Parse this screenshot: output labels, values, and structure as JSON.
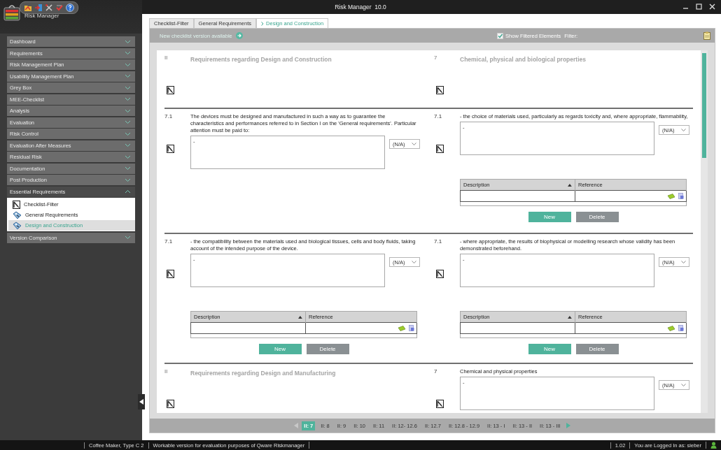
{
  "window": {
    "title": "Risk Manager  10.0"
  },
  "app": {
    "name": "Risk Manager"
  },
  "sidebar": {
    "items": [
      {
        "label": "Dashboard",
        "expanded": false
      },
      {
        "label": "Requirements",
        "expanded": false
      },
      {
        "label": "Risk Management Plan",
        "expanded": false
      },
      {
        "label": "Usability Management Plan",
        "expanded": false
      },
      {
        "label": "Grey Box",
        "expanded": false
      },
      {
        "label": "MEE-Checklist",
        "expanded": false
      },
      {
        "label": "Analysis",
        "expanded": false
      },
      {
        "label": "Evaluation",
        "expanded": false
      },
      {
        "label": "Risk Control",
        "expanded": false
      },
      {
        "label": "Evaluation After Measures",
        "expanded": false
      },
      {
        "label": "Residual Risk",
        "expanded": false
      },
      {
        "label": "Documentation",
        "expanded": false
      },
      {
        "label": "Post Production",
        "expanded": false
      },
      {
        "label": "Essential Requirements",
        "expanded": true,
        "children": [
          {
            "label": "Checklist-Filter",
            "kind": "filter",
            "selected": false
          },
          {
            "label": "General Requirements",
            "kind": "tag",
            "selected": false
          },
          {
            "label": "Design and Construction",
            "kind": "tag",
            "selected": true
          }
        ]
      },
      {
        "label": "Version Comparison",
        "expanded": false
      }
    ]
  },
  "tabs": [
    {
      "label": "Checklist-Filter",
      "selected": false
    },
    {
      "label": "General Requirements",
      "selected": false
    },
    {
      "label": "Design and Construction",
      "selected": true
    }
  ],
  "toolbar": {
    "notice": "New checklist version available",
    "show_filtered": {
      "label": "Show Filtered Elements",
      "checked": true
    },
    "filter_label": "Filter:"
  },
  "rows": [
    {
      "cells": [
        {
          "kind": "heading",
          "number": "II",
          "text": "Requirements regarding Design and Construction"
        },
        {
          "kind": "heading",
          "number": "7",
          "text": "Chemical, physical and biological properties"
        }
      ]
    },
    {
      "cells": [
        {
          "kind": "item",
          "number": "7.1",
          "text": "The devices must be designed and manufactured in such a way as to guarantee the characteristics and performances referred to in Section I on the 'General requirements'. Particular attention must be paid to:",
          "note": "-",
          "rating": "(N/A)"
        },
        {
          "kind": "item",
          "number": "7.1",
          "text": "- the choice of materials used, particularly as regards toxicity and, where appropriate, flammability,",
          "note": "-",
          "rating": "(N/A)",
          "table": {
            "columns": [
              {
                "label": "Description",
                "sorted": true
              },
              {
                "label": "Reference",
                "sorted": false
              }
            ]
          },
          "buttons": [
            "New",
            "Delete"
          ]
        }
      ]
    },
    {
      "cells": [
        {
          "kind": "item",
          "number": "7.1",
          "text": "- the compatibility between the materials used and biological tissues, cells and body fluids, taking account of the intended purpose of the device.",
          "note": "-",
          "rating": "(N/A)",
          "table": {
            "columns": [
              {
                "label": "Description",
                "sorted": true
              },
              {
                "label": "Reference",
                "sorted": false
              }
            ]
          },
          "buttons": [
            "New",
            "Delete"
          ]
        },
        {
          "kind": "item",
          "number": "7.1",
          "text": "- where appropriate, the results of biophysical or modelling research whose validity has been demonstrated beforehand.",
          "note": "-",
          "rating": "(N/A)",
          "table": {
            "columns": [
              {
                "label": "Description",
                "sorted": true
              },
              {
                "label": "Reference",
                "sorted": false
              }
            ]
          },
          "buttons": [
            "New",
            "Delete"
          ]
        }
      ]
    },
    {
      "cells": [
        {
          "kind": "heading",
          "number": "II",
          "text": "Requirements regarding Design and Manufacturing"
        },
        {
          "kind": "item",
          "number": "7",
          "text": "Chemical and physical properties",
          "note": "-",
          "rating": "(N/A)"
        }
      ]
    }
  ],
  "pager": {
    "previous": {
      "disabled": true
    },
    "next": {
      "disabled": false
    },
    "pages": [
      {
        "label": "II: 7",
        "selected": true
      },
      {
        "label": "II: 8",
        "selected": false
      },
      {
        "label": "II: 9",
        "selected": false
      },
      {
        "label": "II: 10",
        "selected": false
      },
      {
        "label": "II: 11",
        "selected": false
      },
      {
        "label": "II: 12- 12.6",
        "selected": false
      },
      {
        "label": "II: 12.7",
        "selected": false
      },
      {
        "label": "II: 12.8 - 12.9",
        "selected": false
      },
      {
        "label": "II: 13 - I",
        "selected": false
      },
      {
        "label": "II: 13 - II",
        "selected": false
      },
      {
        "label": "II: 13 - III",
        "selected": false
      }
    ]
  },
  "status_bar": {
    "project": "Coffee Maker, Type C 2",
    "notice": "Workable version for evaluation purposes of Qware Riskmanager",
    "version": "1.02",
    "user": "You are Logged In as: sieber"
  }
}
